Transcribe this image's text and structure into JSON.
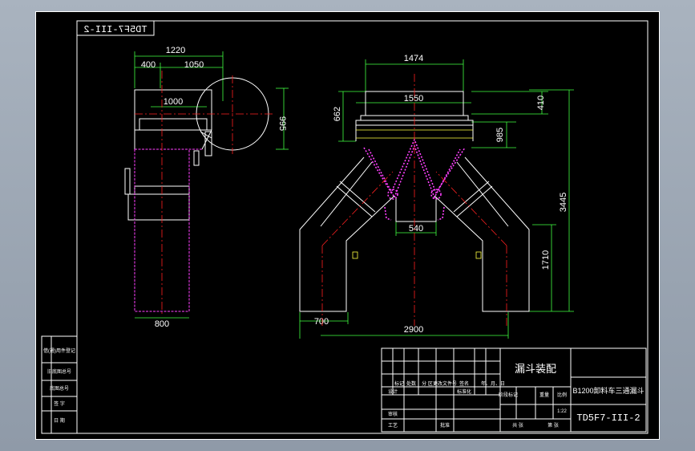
{
  "drawing_number": "TD5F7-III-2",
  "drawing_number_mirrored": "TD5F7-III-2",
  "assembly_title": "漏斗装配",
  "part_name": "B1200卸料车三通漏斗",
  "scale": "1:22",
  "side_view": {
    "dims": {
      "width_total": "1220",
      "left": "400",
      "right": "1050",
      "inner": "1000",
      "height": "995",
      "bottom": "800"
    }
  },
  "front_view": {
    "dims": {
      "top_width": "1474",
      "inner_width": "1550",
      "left_height": "662",
      "right_top": "410",
      "right_mid": "985",
      "total_height": "3445",
      "leg_height": "1710",
      "center_gap": "540",
      "leg_width": "700",
      "base_width": "2900"
    }
  },
  "title_block": {
    "row_labels": [
      "标记",
      "处数",
      "分 区",
      "更改文件号",
      "签名",
      "年、月、日"
    ],
    "design": "设计",
    "standardize": "标准化",
    "review": "审核",
    "process": "工艺",
    "approve": "批准",
    "stage_mark": "阶段标记",
    "weight": "重量",
    "ratio": "比例",
    "sheets_total": "共 张",
    "sheet_no": "第 张"
  },
  "left_strip": {
    "labels": [
      "借(通)用件登记",
      "旧底图总号",
      "底图总号",
      "签 字",
      "日 期"
    ]
  },
  "colors": {
    "border": "#ffffff",
    "red": "#ff2020",
    "magenta": "#ff40ff",
    "yellow": "#ffff40",
    "green": "#40ff40",
    "white": "#ffffff"
  }
}
